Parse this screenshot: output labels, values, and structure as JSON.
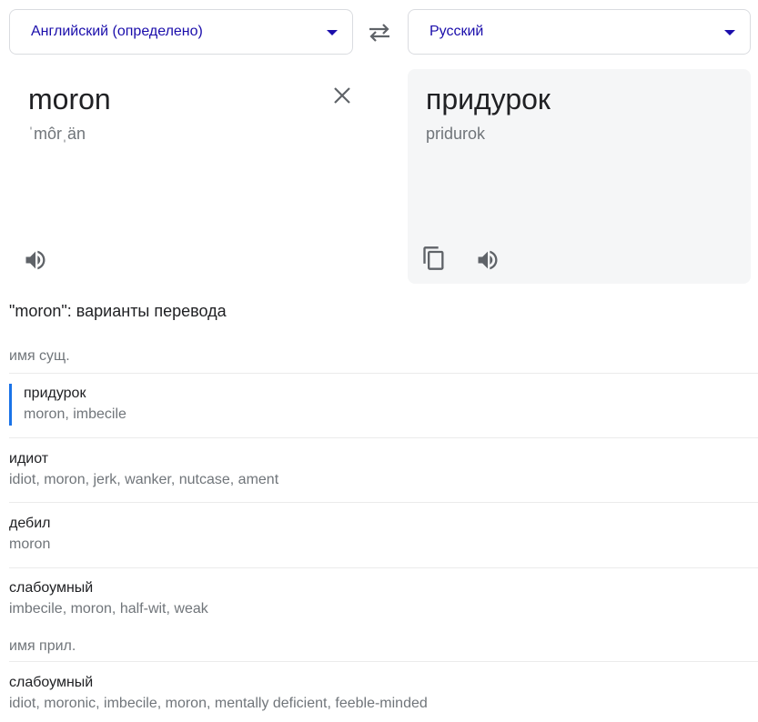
{
  "source_lang": {
    "label": "Английский (определено)"
  },
  "target_lang": {
    "label": "Русский"
  },
  "source": {
    "text": "moron",
    "transliteration": "ˈmôrˌän"
  },
  "target": {
    "text": "придурок",
    "transliteration": "pridurok"
  },
  "icons": {
    "swap": "swap-arrows-icon",
    "clear": "close-icon",
    "listen": "speaker-icon",
    "copy": "copy-icon",
    "dropdown": "caret-down-icon"
  },
  "colors": {
    "link": "#1a0dab",
    "accent": "#1a73e8",
    "muted": "#70757a",
    "target_bg": "#f5f6f7"
  },
  "variants": {
    "heading": "\"moron\": варианты перевода",
    "groups": [
      {
        "pos": "имя сущ.",
        "entries": [
          {
            "term": "придурок",
            "synonyms": "moron, imbecile",
            "selected": true
          },
          {
            "term": "идиот",
            "synonyms": "idiot, moron, jerk, wanker, nutcase, ament"
          },
          {
            "term": "дебил",
            "synonyms": "moron"
          },
          {
            "term": "слабоумный",
            "synonyms": "imbecile, moron, half-wit, weak"
          }
        ]
      },
      {
        "pos": "имя прил.",
        "entries": [
          {
            "term": "слабоумный",
            "synonyms": "idiot, moronic, imbecile, moron, mentally deficient, feeble-minded"
          }
        ]
      }
    ]
  }
}
